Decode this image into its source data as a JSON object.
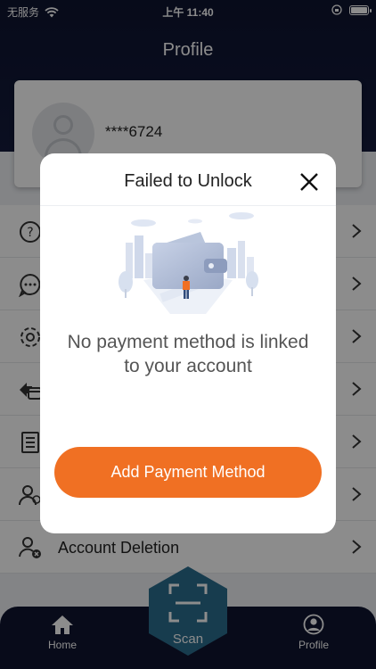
{
  "status_bar": {
    "carrier": "无服务",
    "time": "上午 11:40"
  },
  "header": {
    "title": "Profile"
  },
  "profile": {
    "masked_phone": "****6724"
  },
  "menu": {
    "items": [
      {
        "icon": "help-circle-icon",
        "label": ""
      },
      {
        "icon": "chat-bubble-icon",
        "label": ""
      },
      {
        "icon": "gear-icon",
        "label": ""
      },
      {
        "icon": "payment-card-icon",
        "label": ""
      },
      {
        "icon": "document-list-icon",
        "label": ""
      },
      {
        "icon": "users-icon",
        "label": ""
      },
      {
        "icon": "user-delete-icon",
        "label": "Account Deletion"
      }
    ]
  },
  "tab_bar": {
    "home_label": "Home",
    "scan_label": "Scan",
    "profile_label": "Profile"
  },
  "modal": {
    "title": "Failed to Unlock",
    "message": "No payment method is linked to your account",
    "button_label": "Add Payment Method"
  },
  "colors": {
    "accent": "#f07023",
    "header_bg": "#0e1430",
    "scan_hex": "#2b6d8f"
  }
}
